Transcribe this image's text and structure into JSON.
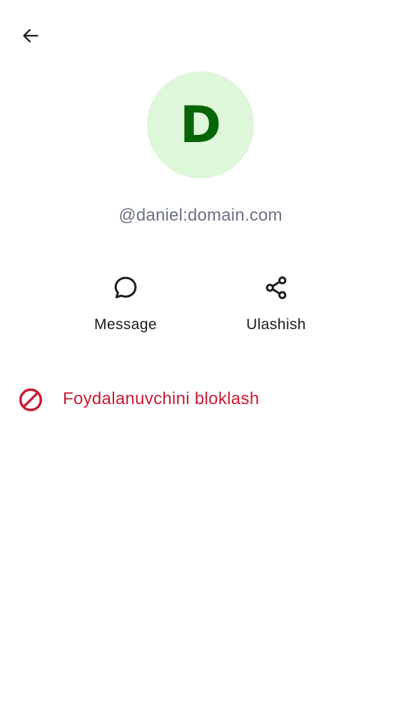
{
  "header": {
    "back_icon": "arrow-left-icon"
  },
  "profile": {
    "avatar_letter": "D",
    "avatar_bg": "#def6d9",
    "avatar_fg": "#076407",
    "user_id": "@daniel:domain.com"
  },
  "actions": [
    {
      "label": "Message",
      "icon": "chat-bubble-icon"
    },
    {
      "label": "Ulashish",
      "icon": "share-icon"
    }
  ],
  "block": {
    "label": "Foydalanuvchini bloklash",
    "icon": "block-icon",
    "color": "#c81b33"
  }
}
